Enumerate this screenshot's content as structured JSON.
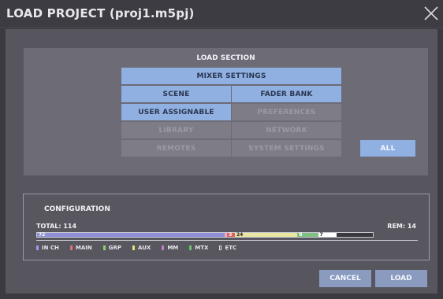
{
  "window": {
    "title": "LOAD PROJECT (proj1.m5pj)"
  },
  "load_section": {
    "title": "LOAD SECTION",
    "buttons": {
      "mixer_settings": "MIXER SETTINGS",
      "scene": "SCENE",
      "fader_bank": "FADER BANK",
      "user_assignable": "USER ASSIGNABLE",
      "preferences": "PREFERENCES",
      "library": "LIBRARY",
      "network": "NETWORK",
      "remotes": "REMOTES",
      "system_settings": "SYSTEM SETTINGS",
      "all": "ALL"
    }
  },
  "configuration": {
    "title": "CONFIGURATION",
    "total_label": "TOTAL: 114",
    "rem_label": "REM: 14",
    "segments": [
      {
        "label": "72",
        "value": 72,
        "color": "#8f8fd8"
      },
      {
        "label": "",
        "value": 1,
        "color": "#f2a7c0"
      },
      {
        "label": "3",
        "value": 3,
        "color": "#e06060"
      },
      {
        "label": "24",
        "value": 24,
        "color": "#e8e6a0"
      },
      {
        "label": "8",
        "value": 8,
        "color": "#7fbf7f"
      },
      {
        "label": "7",
        "value": 7,
        "color": "#ffffff"
      },
      {
        "label": "",
        "value": 14,
        "color": "#3a3940"
      }
    ],
    "legend": [
      {
        "label": "IN CH",
        "color": "#9b9be8"
      },
      {
        "label": "MAIN",
        "color": "#e07070"
      },
      {
        "label": "GRP",
        "color": "#8fcf70"
      },
      {
        "label": "AUX",
        "color": "#e8e070"
      },
      {
        "label": "MM",
        "color": "#c080d0"
      },
      {
        "label": "MTX",
        "color": "#6fbf6f"
      },
      {
        "label": "ETC",
        "color": "#ffffff"
      }
    ]
  },
  "footer": {
    "cancel": "CANCEL",
    "load": "LOAD"
  }
}
